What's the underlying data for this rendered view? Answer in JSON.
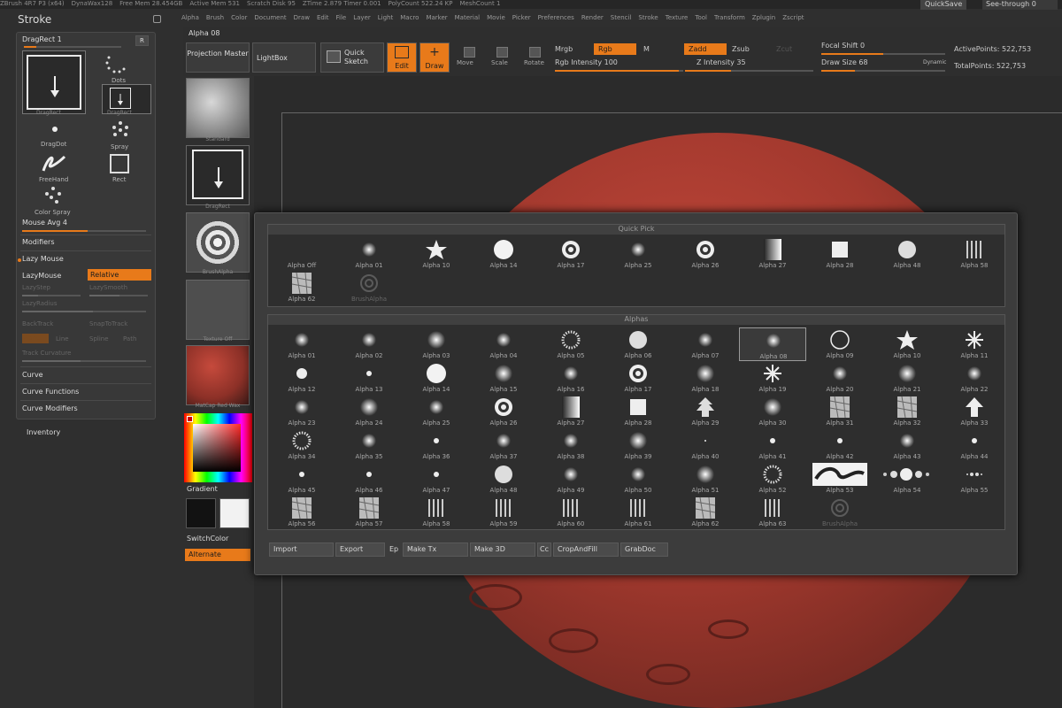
{
  "status": {
    "items": [
      "ZBrush 4R7 P3 (x64)",
      "DynaWax128",
      "Free Mem 28.454GB",
      "Active Mem 531",
      "Scratch Disk 95",
      "ZTime 2.879 Timer 0.001",
      "PolyCount 522.24 KP",
      "MeshCount 1"
    ],
    "quicksave": "QuickSave",
    "seethrough": "See-through  0"
  },
  "menu": [
    "Alpha",
    "Brush",
    "Color",
    "Document",
    "Draw",
    "Edit",
    "File",
    "Layer",
    "Light",
    "Macro",
    "Marker",
    "Material",
    "Movie",
    "Picker",
    "Preferences",
    "Render",
    "Stencil",
    "Stroke",
    "Texture",
    "Tool",
    "Transform",
    "Zplugin",
    "Zscript"
  ],
  "stroke": {
    "title": "Stroke",
    "current": "DragRect 1",
    "r": "R",
    "types": [
      "DragRect",
      "Dots",
      "DragRect",
      "DragDot",
      "Spray",
      "FreeHand",
      "Rect",
      "Color Spray"
    ],
    "mouse_avg": "Mouse Avg 4",
    "modifiers": "Modifiers",
    "lazy_mouse": "Lazy Mouse",
    "lazymouse": "LazyMouse",
    "relative": "Relative",
    "lazystep": "LazyStep",
    "lazysmooth": "LazySmooth",
    "lazyradius": "LazyRadius",
    "backtrack": "BackTrack",
    "snaptotrack": "SnapToTrack",
    "plane": "Plane",
    "line": "Line",
    "spline": "Spline",
    "path": "Path",
    "track_curvature": "Track Curvature",
    "curve": "Curve",
    "curve_functions": "Curve Functions",
    "curve_modifiers": "Curve Modifiers",
    "inventory": "Inventory"
  },
  "toolbar": {
    "alpha_label": "Alpha 08",
    "projection": "Projection Master",
    "lightbox": "LightBox",
    "quick_sketch": "Quick Sketch",
    "edit": "Edit",
    "draw": "Draw",
    "move": "Move",
    "scale": "Scale",
    "rotate": "Rotate",
    "mrgb": "Mrgb",
    "rgb": "Rgb",
    "m": "M",
    "zadd": "Zadd",
    "zsub": "Zsub",
    "zcut": "Zcut",
    "rgb_intensity": "Rgb  Intensity 100",
    "z_intensity": "Z Intensity 35",
    "focal_shift": "Focal Shift 0",
    "draw_size": "Draw Size 68",
    "dynamic": "Dynamic",
    "active_points": "ActivePoints: 522,753",
    "total_points": "TotalPoints: 522,753"
  },
  "strip": {
    "labels": [
      "Standard",
      "DragRect",
      "BrushAlpha",
      "Texture Off",
      "MatCap Red Wax"
    ],
    "gradient": "Gradient",
    "switchcolor": "SwitchColor",
    "alternate": "Alternate"
  },
  "popup": {
    "quick_pick": "Quick Pick",
    "alphas": "Alphas",
    "quick": [
      "Alpha Off",
      "Alpha 01",
      "Alpha 10",
      "Alpha 14",
      "Alpha 17",
      "Alpha 25",
      "Alpha 26",
      "Alpha 27",
      "Alpha 28",
      "Alpha 48",
      "Alpha 58",
      "Alpha 62",
      "BrushAlpha"
    ],
    "grid": [
      "Alpha 01",
      "Alpha 02",
      "Alpha 03",
      "Alpha 04",
      "Alpha 05",
      "Alpha 06",
      "Alpha 07",
      "Alpha 08",
      "Alpha 09",
      "Alpha 10",
      "Alpha 11",
      "Alpha 12",
      "Alpha 13",
      "Alpha 14",
      "Alpha 15",
      "Alpha 16",
      "Alpha 17",
      "Alpha 18",
      "Alpha 19",
      "Alpha 20",
      "Alpha 21",
      "Alpha 22",
      "Alpha 23",
      "Alpha 24",
      "Alpha 25",
      "Alpha 26",
      "Alpha 27",
      "Alpha 28",
      "Alpha 29",
      "Alpha 30",
      "Alpha 31",
      "Alpha 32",
      "Alpha 33",
      "Alpha 34",
      "Alpha 35",
      "Alpha 36",
      "Alpha 37",
      "Alpha 38",
      "Alpha 39",
      "Alpha 40",
      "Alpha 41",
      "Alpha 42",
      "Alpha 43",
      "Alpha 44",
      "Alpha 45",
      "Alpha 46",
      "Alpha 47",
      "Alpha 48",
      "Alpha 49",
      "Alpha 50",
      "Alpha 51",
      "Alpha 52",
      "Alpha 53",
      "Alpha 54",
      "Alpha 55",
      "Alpha 56",
      "Alpha 57",
      "Alpha 58",
      "Alpha 59",
      "Alpha 60",
      "Alpha 61",
      "Alpha 62",
      "Alpha 63",
      "BrushAlpha"
    ],
    "import": "Import",
    "export": "Export",
    "ep": "Ep",
    "make_tx": "Make Tx",
    "make_3d": "Make 3D",
    "cc": "Cc",
    "cropandfill": "CropAndFill",
    "grabdoc": "GrabDoc"
  },
  "colors": {
    "accent": "#e87a1a",
    "sphere": "#a3392e"
  }
}
